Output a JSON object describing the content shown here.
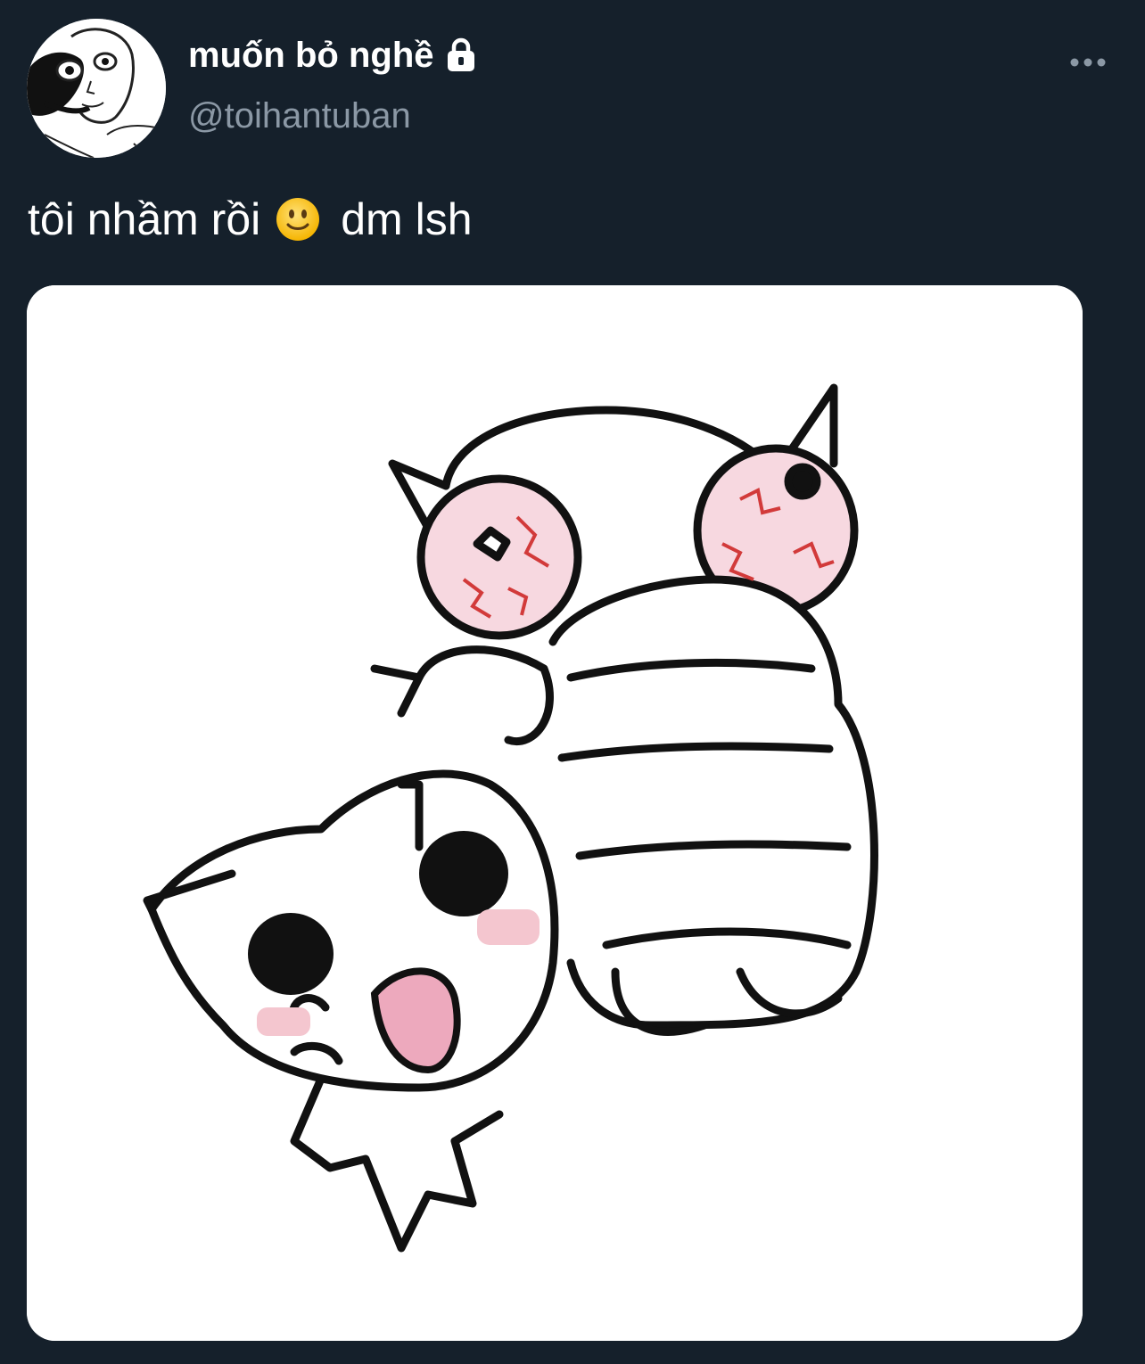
{
  "tweet": {
    "author": {
      "display_name": "muốn bỏ nghề",
      "handle": "@toihantuban",
      "protected_icon": "lock-icon"
    },
    "menu_icon": "more-horizontal-icon",
    "text_before_emoji": "tôi nhầm rồi",
    "emoji": "slightly-smiling-face",
    "text_after_emoji": "dm lsh",
    "media": {
      "type": "image",
      "description_icon": "cat-meme-illustration"
    }
  },
  "colors": {
    "background": "#15202b",
    "name": "#ffffff",
    "handle": "#8b98a5",
    "media_background": "#ffffff"
  }
}
